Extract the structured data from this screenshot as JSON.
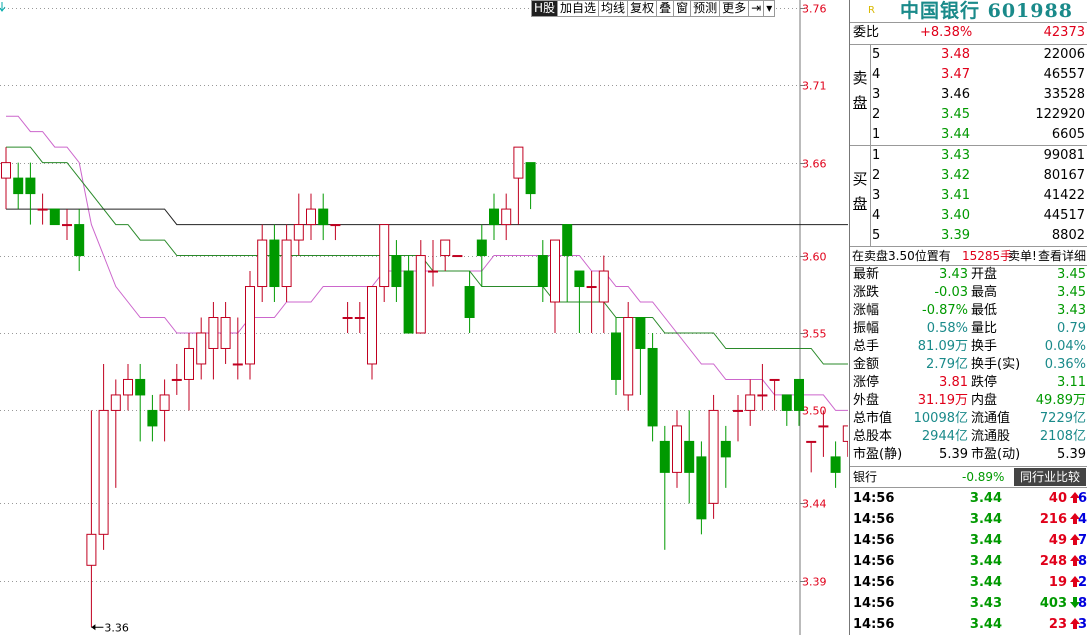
{
  "toolbar": {
    "items": [
      "H股",
      "加自选",
      "均线",
      "复权",
      "叠",
      "窗",
      "预测",
      "更多",
      "⇥",
      "▾"
    ]
  },
  "chart_data": {
    "type": "candlestick",
    "y_axis_ticks": [
      "3.76",
      "3.71",
      "3.66",
      "3.60",
      "3.55",
      "3.50",
      "3.44",
      "3.39"
    ],
    "low_marker": "3.36",
    "ylim": [
      3.355,
      3.765
    ],
    "candles": [
      [
        3.65,
        3.66,
        3.67,
        3.63
      ],
      [
        3.65,
        3.64,
        3.66,
        3.63
      ],
      [
        3.65,
        3.64,
        3.66,
        3.62
      ],
      [
        3.63,
        3.63,
        3.64,
        3.62
      ],
      [
        3.63,
        3.62,
        3.63,
        3.62
      ],
      [
        3.62,
        3.62,
        3.63,
        3.61
      ],
      [
        3.62,
        3.6,
        3.63,
        3.59
      ],
      [
        3.4,
        3.42,
        3.5,
        3.36
      ],
      [
        3.42,
        3.5,
        3.53,
        3.41
      ],
      [
        3.5,
        3.51,
        3.52,
        3.45
      ],
      [
        3.51,
        3.52,
        3.53,
        3.5
      ],
      [
        3.52,
        3.51,
        3.53,
        3.48
      ],
      [
        3.5,
        3.49,
        3.51,
        3.48
      ],
      [
        3.5,
        3.51,
        3.52,
        3.48
      ],
      [
        3.52,
        3.52,
        3.53,
        3.51
      ],
      [
        3.52,
        3.54,
        3.55,
        3.5
      ],
      [
        3.53,
        3.55,
        3.56,
        3.52
      ],
      [
        3.54,
        3.56,
        3.57,
        3.52
      ],
      [
        3.54,
        3.56,
        3.57,
        3.53
      ],
      [
        3.53,
        3.53,
        3.56,
        3.52
      ],
      [
        3.53,
        3.58,
        3.59,
        3.52
      ],
      [
        3.58,
        3.61,
        3.62,
        3.57
      ],
      [
        3.61,
        3.58,
        3.62,
        3.57
      ],
      [
        3.58,
        3.61,
        3.62,
        3.57
      ],
      [
        3.61,
        3.62,
        3.64,
        3.6
      ],
      [
        3.62,
        3.63,
        3.64,
        3.61
      ],
      [
        3.63,
        3.62,
        3.64,
        3.61
      ],
      [
        3.62,
        3.62,
        3.62,
        3.61
      ],
      [
        3.56,
        3.56,
        3.57,
        3.55
      ],
      [
        3.56,
        3.56,
        3.57,
        3.55
      ],
      [
        3.53,
        3.58,
        3.58,
        3.52
      ],
      [
        3.58,
        3.62,
        3.62,
        3.57
      ],
      [
        3.6,
        3.58,
        3.61,
        3.57
      ],
      [
        3.59,
        3.55,
        3.6,
        3.55
      ],
      [
        3.55,
        3.6,
        3.61,
        3.55
      ],
      [
        3.59,
        3.59,
        3.61,
        3.58
      ],
      [
        3.6,
        3.61,
        3.61,
        3.59
      ],
      [
        3.6,
        3.6,
        3.6,
        3.6
      ],
      [
        3.58,
        3.56,
        3.59,
        3.55
      ],
      [
        3.61,
        3.6,
        3.62,
        3.58
      ],
      [
        3.63,
        3.62,
        3.64,
        3.61
      ],
      [
        3.62,
        3.63,
        3.64,
        3.61
      ],
      [
        3.65,
        3.67,
        3.67,
        3.62
      ],
      [
        3.66,
        3.64,
        3.66,
        3.63
      ],
      [
        3.6,
        3.58,
        3.61,
        3.57
      ],
      [
        3.57,
        3.61,
        3.61,
        3.55
      ],
      [
        3.62,
        3.6,
        3.62,
        3.57
      ],
      [
        3.59,
        3.58,
        3.59,
        3.55
      ],
      [
        3.58,
        3.58,
        3.59,
        3.55
      ],
      [
        3.57,
        3.59,
        3.6,
        3.55
      ],
      [
        3.55,
        3.52,
        3.56,
        3.51
      ],
      [
        3.51,
        3.56,
        3.57,
        3.5
      ],
      [
        3.56,
        3.54,
        3.56,
        3.51
      ],
      [
        3.54,
        3.49,
        3.55,
        3.48
      ],
      [
        3.48,
        3.46,
        3.49,
        3.41
      ],
      [
        3.46,
        3.49,
        3.5,
        3.45
      ],
      [
        3.48,
        3.46,
        3.5,
        3.44
      ],
      [
        3.47,
        3.43,
        3.48,
        3.42
      ],
      [
        3.44,
        3.5,
        3.51,
        3.43
      ],
      [
        3.48,
        3.47,
        3.49,
        3.45
      ],
      [
        3.5,
        3.5,
        3.51,
        3.48
      ],
      [
        3.5,
        3.51,
        3.52,
        3.49
      ],
      [
        3.51,
        3.51,
        3.53,
        3.5
      ],
      [
        3.52,
        3.52,
        3.52,
        3.5
      ],
      [
        3.51,
        3.5,
        3.51,
        3.49
      ],
      [
        3.52,
        3.5,
        3.52,
        3.49
      ],
      [
        3.48,
        3.48,
        3.48,
        3.46
      ],
      [
        3.49,
        3.49,
        3.5,
        3.47
      ],
      [
        3.47,
        3.46,
        3.48,
        3.45
      ],
      [
        3.48,
        3.49,
        3.49,
        3.47
      ],
      [
        3.48,
        3.48,
        3.49,
        3.47
      ],
      [
        3.49,
        3.51,
        3.52,
        3.48
      ],
      [
        3.5,
        3.5,
        3.51,
        3.49
      ],
      [
        3.49,
        3.5,
        3.51,
        3.48
      ],
      [
        3.5,
        3.51,
        3.51,
        3.5
      ],
      [
        3.51,
        3.51,
        3.52,
        3.5
      ],
      [
        3.51,
        3.53,
        3.55,
        3.5
      ],
      [
        3.52,
        3.55,
        3.57,
        3.51
      ],
      [
        3.55,
        3.56,
        3.58,
        3.54
      ],
      [
        3.56,
        3.56,
        3.57,
        3.55
      ],
      [
        3.53,
        3.55,
        3.56,
        3.52
      ],
      [
        3.55,
        3.59,
        3.59,
        3.53
      ],
      [
        3.58,
        3.55,
        3.59,
        3.54
      ],
      [
        3.55,
        3.56,
        3.58,
        3.53
      ],
      [
        3.55,
        3.53,
        3.58,
        3.52
      ],
      [
        3.53,
        3.53,
        3.55,
        3.52
      ],
      [
        3.49,
        3.45,
        3.49,
        3.43
      ],
      [
        3.45,
        3.43,
        3.45,
        3.42
      ]
    ],
    "ma": [
      {
        "color": "#cc66cc",
        "values": [
          3.69,
          3.69,
          3.68,
          3.68,
          3.67,
          3.67,
          3.66,
          3.62,
          3.6,
          3.58,
          3.57,
          3.56,
          3.56,
          3.56,
          3.55,
          3.55,
          3.55,
          3.55,
          3.55,
          3.55,
          3.56,
          3.56,
          3.56,
          3.57,
          3.57,
          3.57,
          3.58,
          3.58,
          3.58,
          3.58,
          3.58,
          3.59,
          3.59,
          3.59,
          3.59,
          3.59,
          3.59,
          3.59,
          3.59,
          3.59,
          3.6,
          3.6,
          3.6,
          3.6,
          3.6,
          3.6,
          3.6,
          3.6,
          3.59,
          3.59,
          3.58,
          3.58,
          3.57,
          3.57,
          3.56,
          3.55,
          3.54,
          3.53,
          3.53,
          3.52,
          3.52,
          3.52,
          3.52,
          3.51,
          3.51,
          3.51,
          3.51,
          3.51,
          3.5,
          3.5,
          3.5,
          3.5,
          3.5,
          3.5,
          3.5,
          3.5,
          3.51,
          3.51,
          3.51,
          3.52,
          3.52,
          3.52,
          3.52,
          3.52,
          3.52,
          3.52,
          3.52,
          3.51
        ]
      },
      {
        "color": "#2a8a2a",
        "values": [
          3.67,
          3.67,
          3.67,
          3.66,
          3.66,
          3.66,
          3.65,
          3.64,
          3.63,
          3.62,
          3.62,
          3.61,
          3.61,
          3.61,
          3.6,
          3.6,
          3.6,
          3.6,
          3.6,
          3.6,
          3.6,
          3.6,
          3.6,
          3.6,
          3.6,
          3.6,
          3.6,
          3.6,
          3.6,
          3.6,
          3.6,
          3.6,
          3.6,
          3.6,
          3.6,
          3.59,
          3.59,
          3.59,
          3.59,
          3.58,
          3.58,
          3.58,
          3.58,
          3.58,
          3.58,
          3.57,
          3.57,
          3.57,
          3.57,
          3.57,
          3.56,
          3.56,
          3.56,
          3.56,
          3.55,
          3.55,
          3.55,
          3.55,
          3.55,
          3.54,
          3.54,
          3.54,
          3.54,
          3.54,
          3.54,
          3.54,
          3.54,
          3.53,
          3.53,
          3.53,
          3.53,
          3.53,
          3.53,
          3.53,
          3.53,
          3.53,
          3.53,
          3.53,
          3.53,
          3.53,
          3.53,
          3.53,
          3.53,
          3.53,
          3.53,
          3.53,
          3.52,
          3.52
        ]
      },
      {
        "color": "#222222",
        "values": [
          3.63,
          3.63,
          3.63,
          3.63,
          3.63,
          3.63,
          3.63,
          3.63,
          3.63,
          3.63,
          3.63,
          3.63,
          3.63,
          3.63,
          3.62,
          3.62,
          3.62,
          3.62,
          3.62,
          3.62,
          3.62,
          3.62,
          3.62,
          3.62,
          3.62,
          3.62,
          3.62,
          3.62,
          3.62,
          3.62,
          3.62,
          3.62,
          3.62,
          3.62,
          3.62,
          3.62,
          3.62,
          3.62,
          3.62,
          3.62,
          3.62,
          3.62,
          3.62,
          3.62,
          3.62,
          3.62,
          3.62,
          3.62,
          3.62,
          3.62,
          3.62,
          3.62,
          3.62,
          3.62,
          3.62,
          3.62,
          3.62,
          3.62,
          3.62,
          3.62,
          3.62,
          3.62,
          3.62,
          3.62,
          3.62,
          3.62,
          3.62,
          3.62,
          3.62,
          3.62,
          3.62,
          3.62,
          3.62,
          3.62,
          3.62,
          3.62,
          3.61,
          3.61,
          3.61,
          3.61,
          3.61,
          3.61,
          3.61,
          3.61,
          3.61,
          3.6,
          3.6,
          3.6
        ]
      }
    ]
  },
  "stock": {
    "badge": "R",
    "name": "中国银行 601988"
  },
  "weibi": {
    "label": "委比",
    "pct": "+8.38%",
    "diff": "42373"
  },
  "sell": {
    "side": "卖盘",
    "levels": [
      {
        "lv": "5",
        "price": "3.48",
        "vol": "22006",
        "color": "red"
      },
      {
        "lv": "4",
        "price": "3.47",
        "vol": "46557",
        "color": "red"
      },
      {
        "lv": "3",
        "price": "3.46",
        "vol": "33528",
        "color": "blk"
      },
      {
        "lv": "2",
        "price": "3.45",
        "vol": "122920",
        "color": "green"
      },
      {
        "lv": "1",
        "price": "3.44",
        "vol": "6605",
        "color": "green"
      }
    ]
  },
  "buy": {
    "side": "买盘",
    "levels": [
      {
        "lv": "1",
        "price": "3.43",
        "vol": "99081",
        "color": "green"
      },
      {
        "lv": "2",
        "price": "3.42",
        "vol": "80167",
        "color": "green"
      },
      {
        "lv": "3",
        "price": "3.41",
        "vol": "41422",
        "color": "green"
      },
      {
        "lv": "4",
        "price": "3.40",
        "vol": "44517",
        "color": "green"
      },
      {
        "lv": "5",
        "price": "3.39",
        "vol": "8802",
        "color": "green"
      }
    ]
  },
  "order_info": {
    "text": "在卖盘3.50位置有",
    "vol": "15285手",
    "label": "卖单!",
    "link": "查看详细"
  },
  "quote": [
    {
      "l1": "最新",
      "v1": "3.43",
      "c1": "green",
      "l2": "开盘",
      "v2": "3.45",
      "c2": "green"
    },
    {
      "l1": "涨跌",
      "v1": "-0.03",
      "c1": "green",
      "l2": "最高",
      "v2": "3.45",
      "c2": "green"
    },
    {
      "l1": "涨幅",
      "v1": "-0.87%",
      "c1": "green",
      "l2": "最低",
      "v2": "3.43",
      "c2": "green"
    },
    {
      "l1": "振幅",
      "v1": "0.58%",
      "c1": "teal",
      "l2": "量比",
      "v2": "0.79",
      "c2": "teal"
    },
    {
      "l1": "总手",
      "v1": "81.09万",
      "c1": "teal",
      "l2": "换手",
      "v2": "0.04%",
      "c2": "teal"
    },
    {
      "l1": "金额",
      "v1": "2.79亿",
      "c1": "teal",
      "l2": "换手(实)",
      "v2": "0.36%",
      "c2": "teal"
    },
    {
      "l1": "涨停",
      "v1": "3.81",
      "c1": "red",
      "l2": "跌停",
      "v2": "3.11",
      "c2": "green"
    },
    {
      "l1": "外盘",
      "v1": "31.19万",
      "c1": "red",
      "l2": "内盘",
      "v2": "49.89万",
      "c2": "green"
    },
    {
      "l1": "总市值",
      "v1": "10098亿",
      "c1": "teal",
      "l2": "流通值",
      "v2": "7229亿",
      "c2": "teal"
    },
    {
      "l1": "总股本",
      "v1": "2944亿",
      "c1": "teal",
      "l2": "流通股",
      "v2": "2108亿",
      "c2": "teal"
    },
    {
      "l1": "市盈(静)",
      "v1": "5.39",
      "c1": "blk",
      "l2": "市盈(动)",
      "v2": "5.39",
      "c2": "blk"
    }
  ],
  "compare": {
    "label": "银行",
    "pct": "-0.89%",
    "button": "同行业比较"
  },
  "ticks": [
    {
      "time": "14:56",
      "price": "3.44",
      "vol": "40",
      "dir": "up",
      "num": "6"
    },
    {
      "time": "14:56",
      "price": "3.44",
      "vol": "216",
      "dir": "up",
      "num": "4"
    },
    {
      "time": "14:56",
      "price": "3.44",
      "vol": "49",
      "dir": "up",
      "num": "7"
    },
    {
      "time": "14:56",
      "price": "3.44",
      "vol": "248",
      "dir": "up",
      "num": "8"
    },
    {
      "time": "14:56",
      "price": "3.44",
      "vol": "19",
      "dir": "up",
      "num": "2"
    },
    {
      "time": "14:56",
      "price": "3.43",
      "vol": "403",
      "dir": "down",
      "num": "8"
    },
    {
      "time": "14:56",
      "price": "3.44",
      "vol": "23",
      "dir": "up",
      "num": "3"
    }
  ]
}
